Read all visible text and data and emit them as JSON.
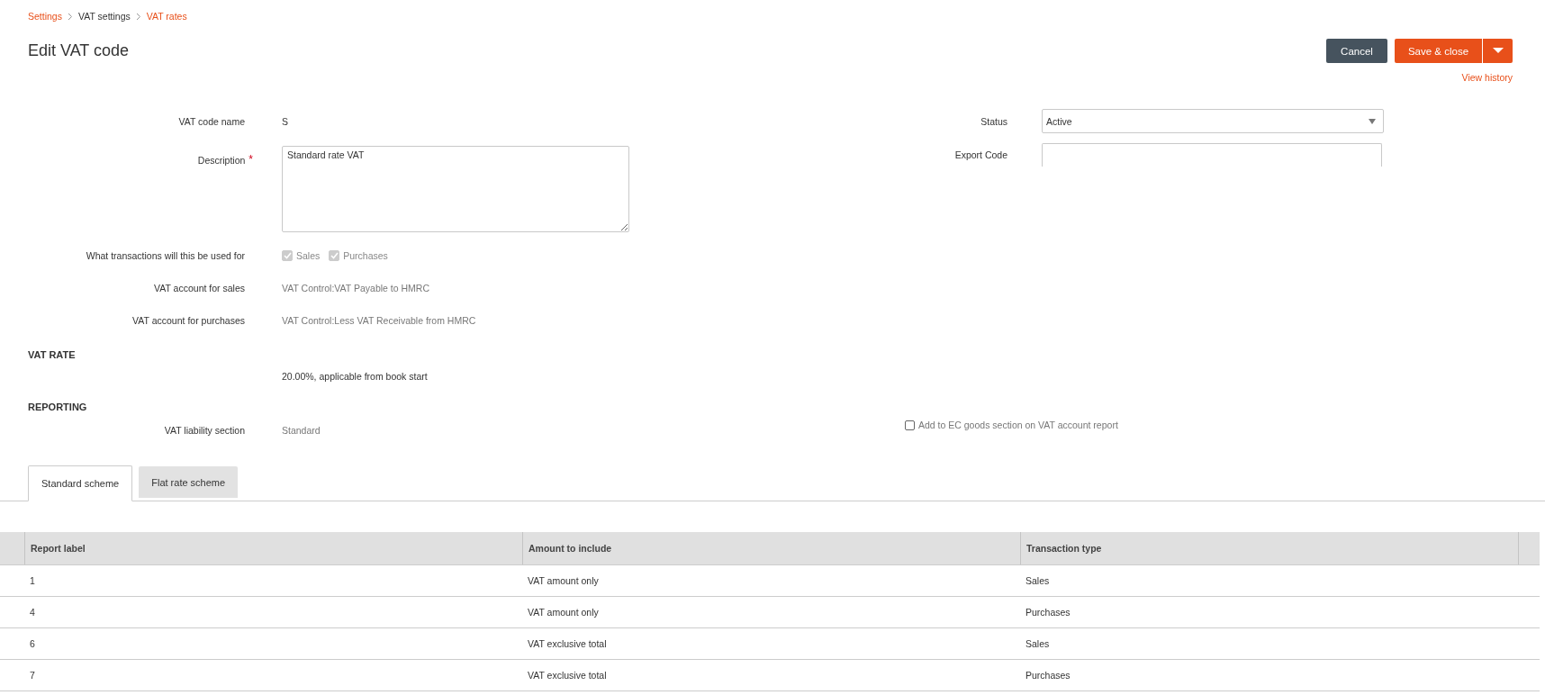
{
  "breadcrumb": [
    {
      "label": "Settings",
      "link": true
    },
    {
      "label": "VAT settings",
      "link": false
    },
    {
      "label": "VAT rates",
      "link": true
    }
  ],
  "title": "Edit VAT code",
  "actions": {
    "cancel": "Cancel",
    "save": "Save & close",
    "view_history": "View history"
  },
  "form": {
    "code_name": {
      "label": "VAT code name",
      "value": "S"
    },
    "description": {
      "label": "Description",
      "required_mark": "*",
      "value": "Standard rate VAT"
    },
    "status": {
      "label": "Status",
      "value": "Active"
    },
    "export_code": {
      "label": "Export Code"
    },
    "transactions": {
      "label": "What transactions will this be used for",
      "options": [
        {
          "label": "Sales",
          "checked": true,
          "disabled": true
        },
        {
          "label": "Purchases",
          "checked": true,
          "disabled": true
        }
      ]
    },
    "sales_account": {
      "label": "VAT account for sales",
      "value": "VAT Control:VAT Payable to HMRC"
    },
    "purchases_account": {
      "label": "VAT account for purchases",
      "value": "VAT Control:Less VAT Receivable from HMRC"
    }
  },
  "vat_rate": {
    "heading": "VAT RATE",
    "value": "20.00%, applicable from book start"
  },
  "reporting": {
    "heading": "REPORTING",
    "liability": {
      "label": "VAT liability section",
      "value": "Standard"
    },
    "ec_goods": {
      "label": "Add to EC goods section on VAT account report",
      "checked": false
    }
  },
  "tabs": [
    {
      "label": "Standard scheme",
      "selected": true
    },
    {
      "label": "Flat rate scheme",
      "selected": false
    }
  ],
  "table": {
    "columns": [
      "Report label",
      "Amount to include",
      "Transaction type"
    ],
    "rows": [
      [
        "1",
        "VAT amount only",
        "Sales"
      ],
      [
        "4",
        "VAT amount only",
        "Purchases"
      ],
      [
        "6",
        "VAT exclusive total",
        "Sales"
      ],
      [
        "7",
        "VAT exclusive total",
        "Purchases"
      ]
    ]
  }
}
